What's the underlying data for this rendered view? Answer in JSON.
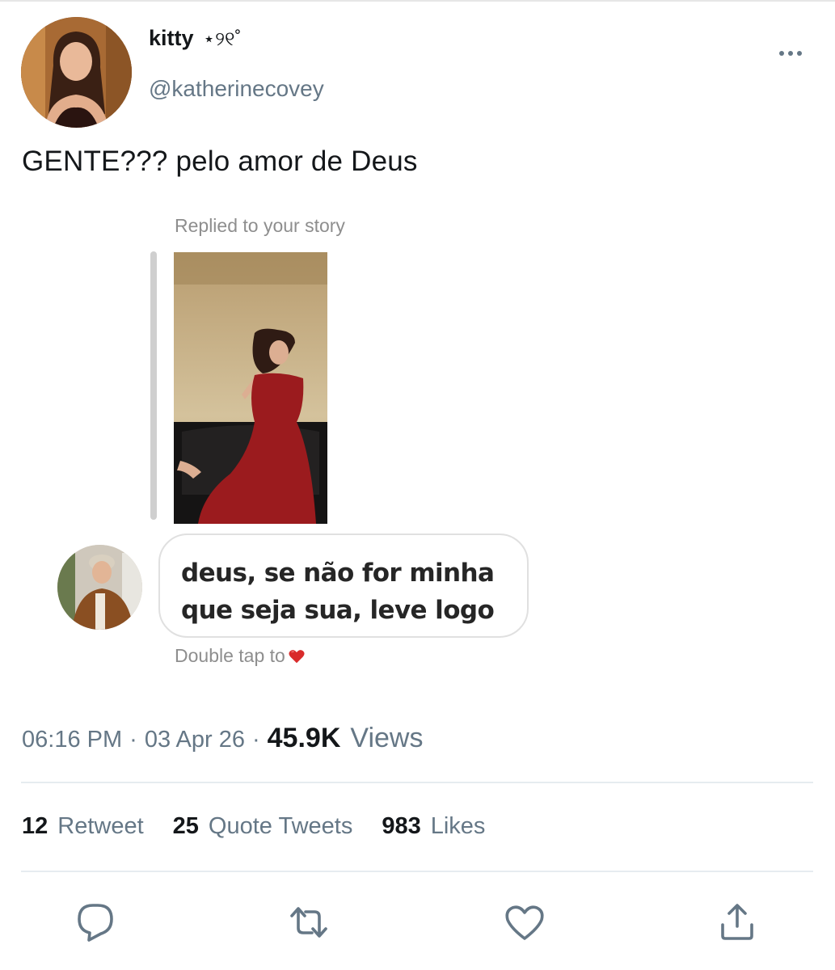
{
  "author": {
    "display_name": "kitty",
    "name_decoration": "⋆୨୧˚",
    "handle": "@katherinecovey"
  },
  "tweet": {
    "text": "GENTE??? pelo amor de Deus"
  },
  "embedded_dm": {
    "replied_label": "Replied to your story",
    "message": "deus, se não for minha que seja sua, leve logo",
    "double_tap_label": "Double tap to",
    "heart_icon": "red-heart-emoji"
  },
  "meta": {
    "time": "06:16 PM",
    "date": "03 Apr 26",
    "separator": "·",
    "views_count": "45.9K",
    "views_label": "Views"
  },
  "stats": {
    "retweets_count": "12",
    "retweets_label": "Retweet",
    "quotes_count": "25",
    "quotes_label": "Quote Tweets",
    "likes_count": "983",
    "likes_label": "Likes"
  },
  "actions": {
    "reply_icon": "reply-icon",
    "retweet_icon": "retweet-icon",
    "like_icon": "heart-icon",
    "share_icon": "share-icon"
  },
  "colors": {
    "text_primary": "#14171a",
    "text_secondary": "#657786",
    "dm_secondary": "#8e8e8e",
    "divider": "#e6ecf0",
    "heart": "#e0245e"
  }
}
